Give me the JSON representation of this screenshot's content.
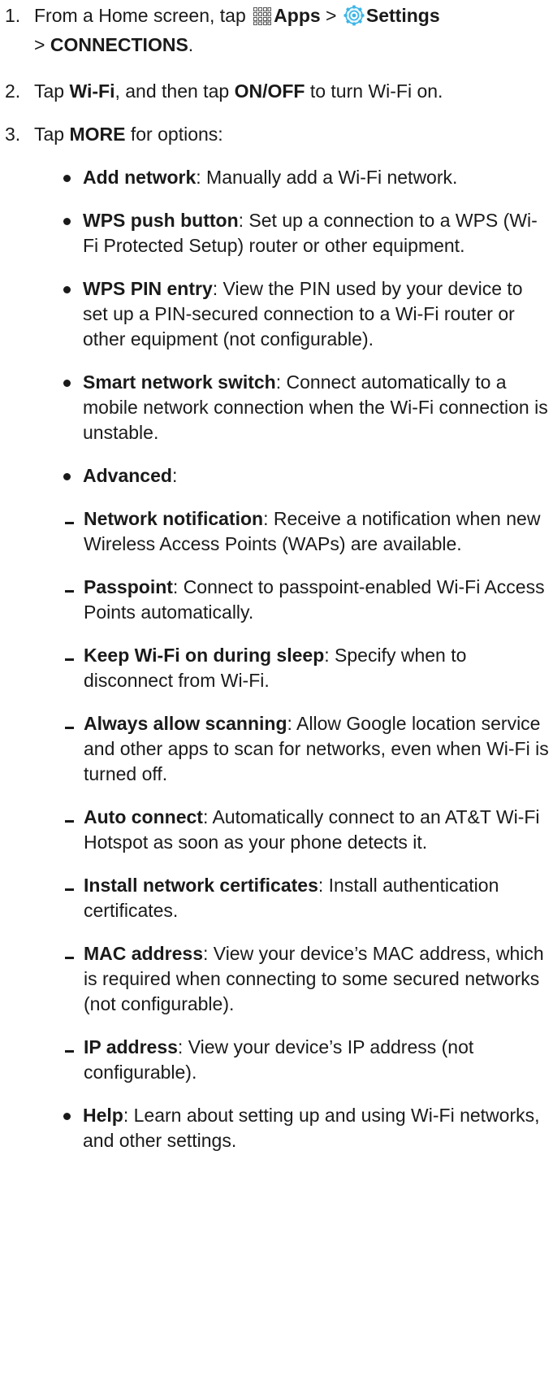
{
  "steps": [
    {
      "num": "1.",
      "pre": "From a Home screen, tap",
      "apps_label": "Apps",
      "sep": ">",
      "settings_label": "Settings",
      "sep2": ">",
      "connections_label": "CONNECTIONS",
      "end": "."
    },
    {
      "num": "2.",
      "pre": "Tap",
      "wifi_label": "Wi-Fi",
      "mid": ", and then tap",
      "onoff_label": "ON/OFF",
      "post": "to turn Wi-Fi on."
    },
    {
      "num": "3.",
      "pre": "Tap",
      "more_label": "MORE",
      "post": "for options:"
    }
  ],
  "options": [
    {
      "term": "Add network",
      "desc": ": Manually add a Wi-Fi network."
    },
    {
      "term": "WPS push button",
      "desc": ": Set up a connection to a WPS (Wi-Fi Protected Setup) router or other equipment."
    },
    {
      "term": "WPS PIN entry",
      "desc": ": View the PIN used by your device to set up a PIN-secured connection to a Wi-Fi router or other equipment (not configurable)."
    },
    {
      "term": "Smart network switch",
      "desc": ": Connect automatically to a mobile network connection when the Wi-Fi connection is unstable."
    },
    {
      "term": "Advanced",
      "desc": ":"
    }
  ],
  "advanced": [
    {
      "term": "Network notification",
      "desc": ": Receive a notification when new Wireless Access Points (WAPs) are available."
    },
    {
      "term": "Passpoint",
      "desc": ": Connect to passpoint-enabled Wi-Fi Access Points automatically."
    },
    {
      "term": "Keep Wi-Fi on during sleep",
      "desc": ": Specify when to disconnect from Wi-Fi."
    },
    {
      "term": "Always allow scanning",
      "desc": ": Allow Google location service and other apps to scan for networks, even when Wi-Fi is turned off."
    },
    {
      "term": "Auto connect",
      "desc": ": Automatically connect to an AT&T Wi-Fi Hotspot as soon as your phone detects it."
    },
    {
      "term": "Install network certificates",
      "desc": ": Install authentication certificates."
    },
    {
      "term": "MAC address",
      "desc": ": View your device’s MAC address, which is required when connecting to some secured networks (not configurable)."
    },
    {
      "term": "IP address",
      "desc": ": View your device’s IP address (not configurable)."
    }
  ],
  "help": {
    "term": "Help",
    "desc": ": Learn about setting up and using Wi-Fi networks, and other settings."
  },
  "icons": {
    "apps": "apps-grid-icon",
    "settings": "settings-gear-icon",
    "settings_color": "#3cb4e6"
  }
}
